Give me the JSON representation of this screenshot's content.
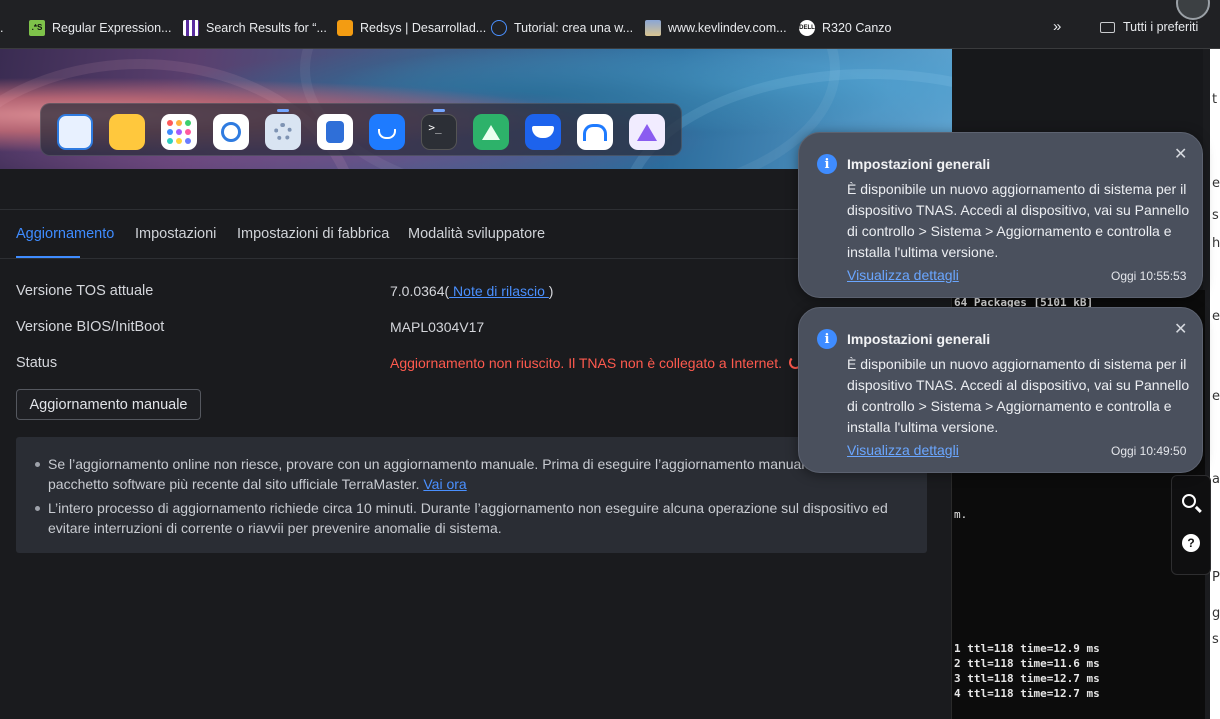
{
  "browser": {
    "bookmarks": [
      {
        "label": "Regular Expression...",
        "icon": "regex-favicon"
      },
      {
        "label": "Search Results for “...",
        "icon": "film-favicon"
      },
      {
        "label": "Redsys | Desarrollad...",
        "icon": "redsys-favicon"
      },
      {
        "label": "Tutorial: crea una w...",
        "icon": "globe-favicon"
      },
      {
        "label": "www.kevlindev.com...",
        "icon": "image-favicon"
      },
      {
        "label": "R320 Canzo",
        "icon": "dell-favicon"
      }
    ],
    "more_label": "»",
    "all_bookmarks_label": "Tutti i preferiti"
  },
  "dock": {
    "apps": [
      "file-manager-app",
      "notes-app",
      "app-center",
      "backup-app",
      "control-panel-app",
      "storage-manager-app",
      "app-store",
      "terminal-app",
      "tdas-app",
      "docker-app",
      "support-app",
      "jellyfin-app"
    ]
  },
  "tabs": [
    {
      "label": "Aggiornamento",
      "active": true
    },
    {
      "label": "Impostazioni",
      "active": false
    },
    {
      "label": "Impostazioni di fabbrica",
      "active": false
    },
    {
      "label": "Modalità sviluppatore",
      "active": false
    }
  ],
  "rows": {
    "tos_label": "Versione TOS attuale",
    "tos_value": "7.0.0364(",
    "tos_link": " Note di rilascio ",
    "tos_close": ")",
    "bios_label": "Versione BIOS/InitBoot",
    "bios_value": "MAPL0304V17",
    "status_label": "Status",
    "status_value": "Aggiornamento non riuscito. Il TNAS non è collegato a Internet."
  },
  "manual_button": "Aggiornamento manuale",
  "info": {
    "item1": "Se l’aggiornamento online non riesce, provare con un aggiornamento manuale. Prima di eseguire l’aggiornamento manuale,",
    "item1b": "pacchetto software più recente dal sito ufficiale TerraMaster. ",
    "item1_link": "Vai ora",
    "item2": "L’intero processo di aggiornamento richiede circa 10 minuti. Durante l’aggiornamento non eseguire alcuna operazione sul dispositivo ed evitare interruzioni di corrente o riavvii per prevenire anomalie di sistema."
  },
  "notifications": [
    {
      "title": "Impostazioni generali",
      "body": "È disponibile un nuovo aggiornamento di sistema per il dispositivo TNAS. Accedi al dispositivo, vai su Pannello di controllo > Sistema > Aggiornamento e controlla e installa l'ultima versione.",
      "link": "Visualizza dettagli",
      "time": "Oggi 10:55:53"
    },
    {
      "title": "Impostazioni generali",
      "body": "È disponibile un nuovo aggiornamento di sistema per il dispositivo TNAS. Accedi al dispositivo, vai su Pannello di controllo > Sistema > Aggiornamento e controlla e installa l'ultima versione.",
      "link": "Visualizza dettagli",
      "time": "Oggi 10:49:50"
    }
  ],
  "terminal": {
    "lines": [
      "64 Packages [5101 kB]",
      "m.",
      "1 ttl=118 time=12.9 ms",
      "2 ttl=118 time=11.6 ms",
      "3 ttl=118 time=12.7 ms",
      "4 ttl=118 time=12.7 ms"
    ]
  },
  "side_tools": {
    "help_glyph": "?"
  },
  "edge_chars": [
    "t",
    "e",
    "s",
    "h",
    "e",
    "e",
    "a",
    "P",
    "g",
    "s"
  ]
}
